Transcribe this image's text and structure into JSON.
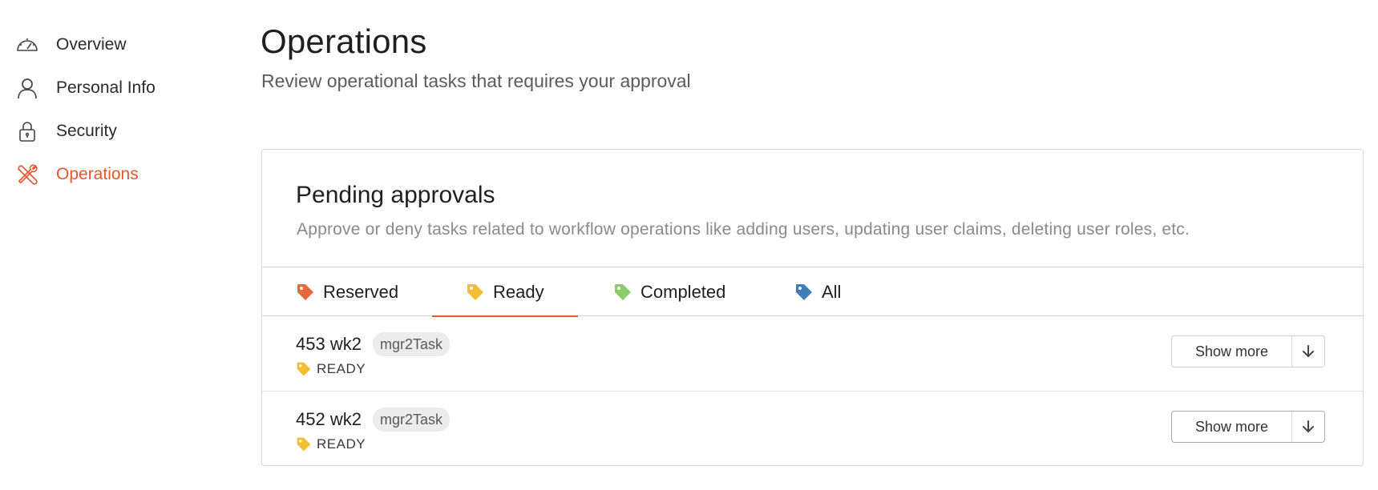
{
  "sidebar": {
    "items": [
      {
        "label": "Overview",
        "icon": "speedometer-icon"
      },
      {
        "label": "Personal Info",
        "icon": "user-icon"
      },
      {
        "label": "Security",
        "icon": "lock-icon"
      },
      {
        "label": "Operations",
        "icon": "tools-icon",
        "active": true
      }
    ]
  },
  "header": {
    "title": "Operations",
    "subtitle": "Review operational tasks that requires your approval"
  },
  "card": {
    "title": "Pending approvals",
    "description": "Approve or deny tasks related to workflow operations like adding users, updating user claims, deleting user roles, etc.",
    "tabs": [
      {
        "label": "Reserved",
        "color": "#e8683f"
      },
      {
        "label": "Ready",
        "color": "#f4bd36",
        "active": true
      },
      {
        "label": "Completed",
        "color": "#8ccb6a"
      },
      {
        "label": "All",
        "color": "#3f7fb5"
      }
    ],
    "tasks": [
      {
        "name": "453 wk2",
        "type": "mgr2Task",
        "status": "READY",
        "action": "Show more"
      },
      {
        "name": "452 wk2",
        "type": "mgr2Task",
        "status": "READY",
        "action": "Show more"
      }
    ]
  },
  "colors": {
    "accent": "#e4572e",
    "ready": "#f4bd36"
  }
}
